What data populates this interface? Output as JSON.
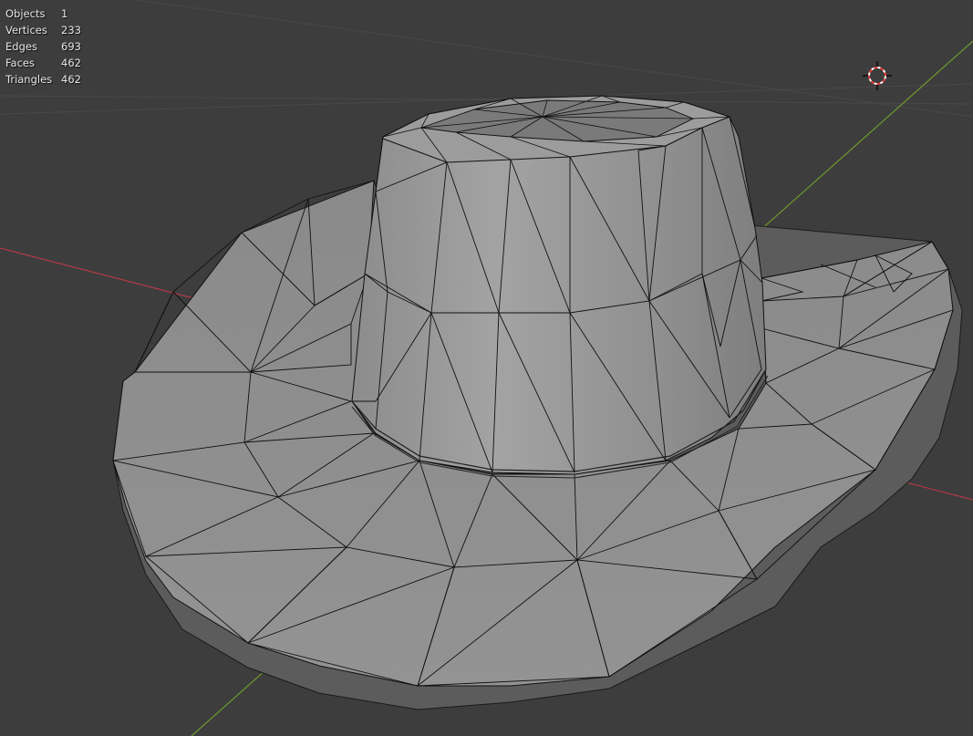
{
  "statistics": [
    {
      "label": "Objects",
      "value": "1"
    },
    {
      "label": "Vertices",
      "value": "233"
    },
    {
      "label": "Edges",
      "value": "693"
    },
    {
      "label": "Faces",
      "value": "462"
    },
    {
      "label": "Triangles",
      "value": "462"
    }
  ],
  "viewport": {
    "background": "#3d3d3d",
    "grid_color": "#4a4a4a",
    "x_axis_color": "#b23a44",
    "y_axis_color": "#6e9a2e",
    "mesh_fill": "#8e8e8e",
    "mesh_wire": "#000000"
  },
  "icons": {
    "cursor": "3d-cursor-icon"
  }
}
